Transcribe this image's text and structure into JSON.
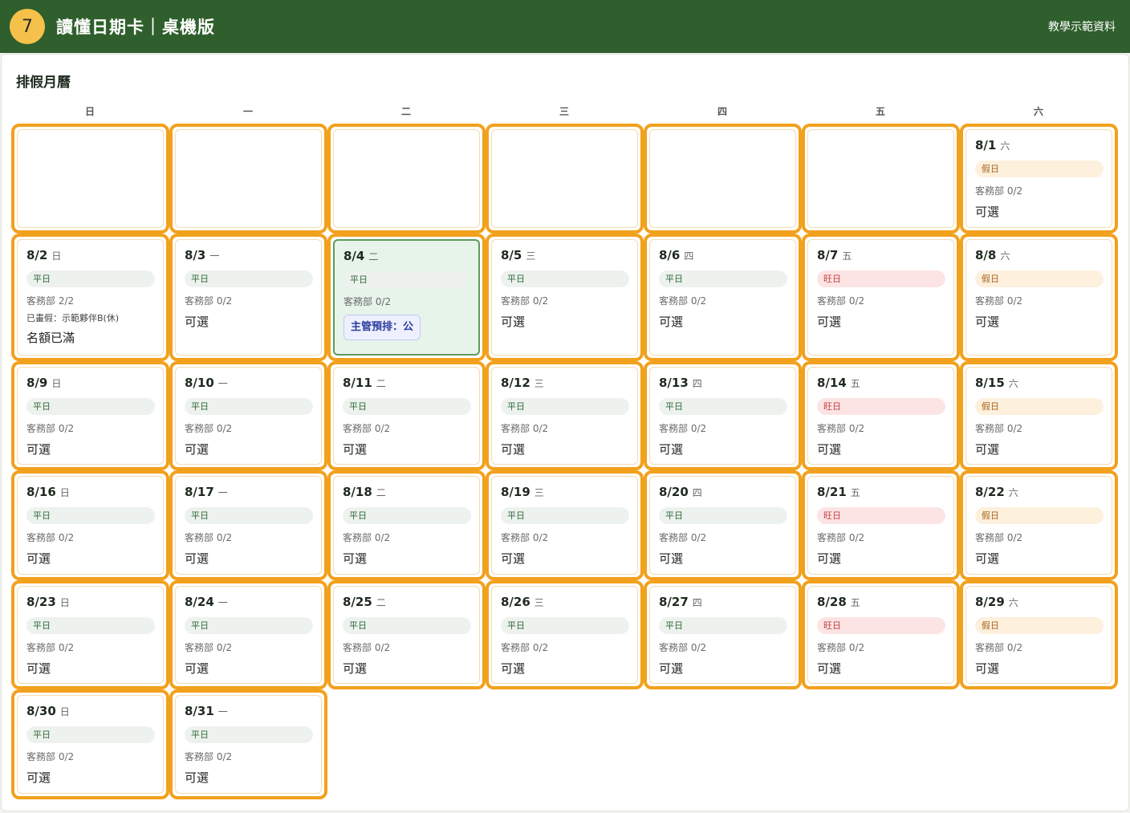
{
  "header": {
    "step": "7",
    "title": "讀懂日期卡｜桌機版",
    "right_label": "教學示範資料"
  },
  "calendar": {
    "title": "排假月曆",
    "weekdays": [
      "日",
      "一",
      "二",
      "三",
      "四",
      "五",
      "六"
    ],
    "days": [
      {
        "date": "8/1",
        "wd": "六",
        "type": "假日",
        "kind": "holiday",
        "quota": "客務部 0/2",
        "status": "可選"
      },
      {
        "date": "8/2",
        "wd": "日",
        "type": "平日",
        "kind": "weekday",
        "quota": "客務部 2/2",
        "taken": "已畫假：示範夥伴B(休)",
        "status": "名額已滿"
      },
      {
        "date": "8/3",
        "wd": "一",
        "type": "平日",
        "kind": "weekday",
        "quota": "客務部 0/2",
        "status": "可選"
      },
      {
        "date": "8/4",
        "wd": "二",
        "type": "平日",
        "kind": "weekday",
        "quota": "客務部 0/2",
        "tag": "主管預排：公",
        "selected": true
      },
      {
        "date": "8/5",
        "wd": "三",
        "type": "平日",
        "kind": "weekday",
        "quota": "客務部 0/2",
        "status": "可選"
      },
      {
        "date": "8/6",
        "wd": "四",
        "type": "平日",
        "kind": "weekday",
        "quota": "客務部 0/2",
        "status": "可選"
      },
      {
        "date": "8/7",
        "wd": "五",
        "type": "旺日",
        "kind": "peak",
        "quota": "客務部 0/2",
        "status": "可選"
      },
      {
        "date": "8/8",
        "wd": "六",
        "type": "假日",
        "kind": "holiday",
        "quota": "客務部 0/2",
        "status": "可選"
      },
      {
        "date": "8/9",
        "wd": "日",
        "type": "平日",
        "kind": "weekday",
        "quota": "客務部 0/2",
        "status": "可選"
      },
      {
        "date": "8/10",
        "wd": "一",
        "type": "平日",
        "kind": "weekday",
        "quota": "客務部 0/2",
        "status": "可選"
      },
      {
        "date": "8/11",
        "wd": "二",
        "type": "平日",
        "kind": "weekday",
        "quota": "客務部 0/2",
        "status": "可選"
      },
      {
        "date": "8/12",
        "wd": "三",
        "type": "平日",
        "kind": "weekday",
        "quota": "客務部 0/2",
        "status": "可選"
      },
      {
        "date": "8/13",
        "wd": "四",
        "type": "平日",
        "kind": "weekday",
        "quota": "客務部 0/2",
        "status": "可選"
      },
      {
        "date": "8/14",
        "wd": "五",
        "type": "旺日",
        "kind": "peak",
        "quota": "客務部 0/2",
        "status": "可選"
      },
      {
        "date": "8/15",
        "wd": "六",
        "type": "假日",
        "kind": "holiday",
        "quota": "客務部 0/2",
        "status": "可選"
      },
      {
        "date": "8/16",
        "wd": "日",
        "type": "平日",
        "kind": "weekday",
        "quota": "客務部 0/2",
        "status": "可選"
      },
      {
        "date": "8/17",
        "wd": "一",
        "type": "平日",
        "kind": "weekday",
        "quota": "客務部 0/2",
        "status": "可選"
      },
      {
        "date": "8/18",
        "wd": "二",
        "type": "平日",
        "kind": "weekday",
        "quota": "客務部 0/2",
        "status": "可選"
      },
      {
        "date": "8/19",
        "wd": "三",
        "type": "平日",
        "kind": "weekday",
        "quota": "客務部 0/2",
        "status": "可選"
      },
      {
        "date": "8/20",
        "wd": "四",
        "type": "平日",
        "kind": "weekday",
        "quota": "客務部 0/2",
        "status": "可選"
      },
      {
        "date": "8/21",
        "wd": "五",
        "type": "旺日",
        "kind": "peak",
        "quota": "客務部 0/2",
        "status": "可選"
      },
      {
        "date": "8/22",
        "wd": "六",
        "type": "假日",
        "kind": "holiday",
        "quota": "客務部 0/2",
        "status": "可選"
      },
      {
        "date": "8/23",
        "wd": "日",
        "type": "平日",
        "kind": "weekday",
        "quota": "客務部 0/2",
        "status": "可選"
      },
      {
        "date": "8/24",
        "wd": "一",
        "type": "平日",
        "kind": "weekday",
        "quota": "客務部 0/2",
        "status": "可選"
      },
      {
        "date": "8/25",
        "wd": "二",
        "type": "平日",
        "kind": "weekday",
        "quota": "客務部 0/2",
        "status": "可選"
      },
      {
        "date": "8/26",
        "wd": "三",
        "type": "平日",
        "kind": "weekday",
        "quota": "客務部 0/2",
        "status": "可選"
      },
      {
        "date": "8/27",
        "wd": "四",
        "type": "平日",
        "kind": "weekday",
        "quota": "客務部 0/2",
        "status": "可選"
      },
      {
        "date": "8/28",
        "wd": "五",
        "type": "旺日",
        "kind": "peak",
        "quota": "客務部 0/2",
        "status": "可選"
      },
      {
        "date": "8/29",
        "wd": "六",
        "type": "假日",
        "kind": "holiday",
        "quota": "客務部 0/2",
        "status": "可選"
      },
      {
        "date": "8/30",
        "wd": "日",
        "type": "平日",
        "kind": "weekday",
        "quota": "客務部 0/2",
        "status": "可選"
      },
      {
        "date": "8/31",
        "wd": "一",
        "type": "平日",
        "kind": "weekday",
        "quota": "客務部 0/2",
        "status": "可選"
      }
    ]
  }
}
